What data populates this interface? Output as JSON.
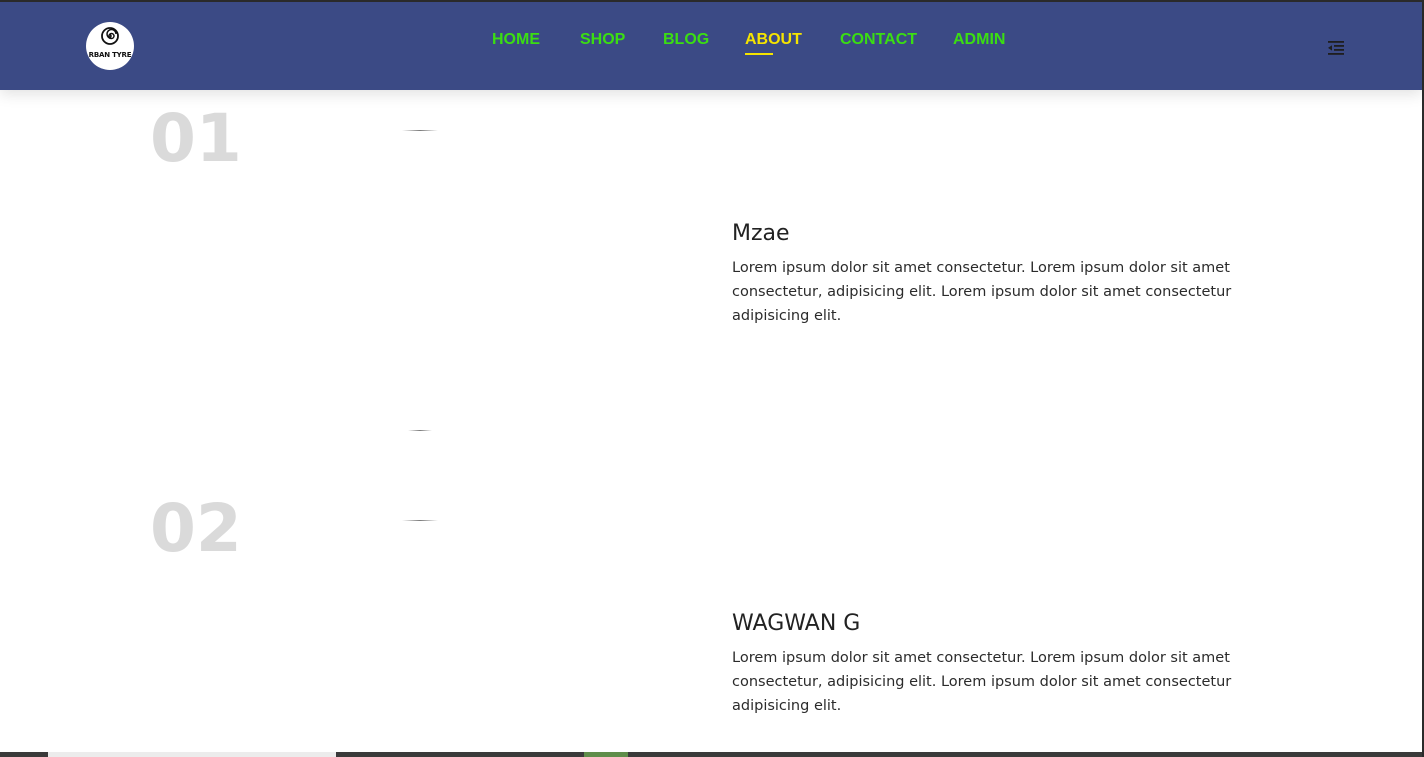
{
  "brand": {
    "logo_text": "RBAN TYRE"
  },
  "nav": {
    "items": [
      {
        "label": "HOME",
        "active": false
      },
      {
        "label": "SHOP",
        "active": false
      },
      {
        "label": "BLOG",
        "active": false
      },
      {
        "label": "ABOUT",
        "active": true
      },
      {
        "label": "CONTACT",
        "active": false
      },
      {
        "label": "ADMIN",
        "active": false
      }
    ],
    "menu_icon": "menu-indent-icon"
  },
  "steps": [
    {
      "number": "01",
      "title": "Mzae",
      "text": "Lorem ipsum dolor sit amet consectetur. Lorem ipsum dolor sit amet consectetur, adipisicing elit. Lorem ipsum dolor sit amet consectetur adipisicing elit."
    },
    {
      "number": "02",
      "title": "WAGWAN G",
      "text": "Lorem ipsum dolor sit amet consectetur. Lorem ipsum dolor sit amet consectetur, adipisicing elit. Lorem ipsum dolor sit amet consectetur adipisicing elit."
    }
  ],
  "colors": {
    "header_bg": "#3b4a85",
    "nav_link": "#3bde12",
    "nav_active": "#f5e400",
    "step_number": "#dadada"
  }
}
